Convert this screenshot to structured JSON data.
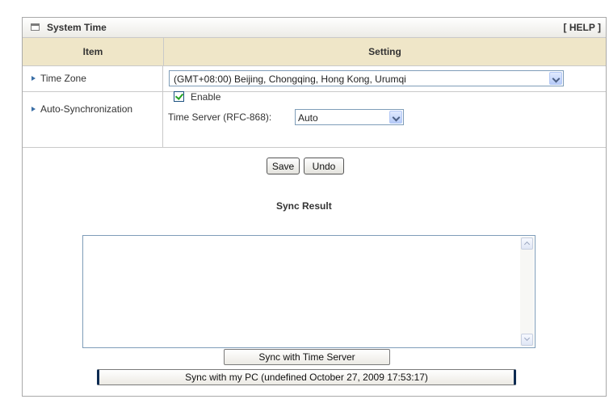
{
  "panel": {
    "title": "System Time",
    "help": "[ HELP ]"
  },
  "table": {
    "col_item": "Item",
    "col_setting": "Setting"
  },
  "time_zone": {
    "label": "Time Zone",
    "selected": "(GMT+08:00) Beijing, Chongqing, Hong Kong, Urumqi"
  },
  "auto_sync": {
    "label": "Auto-Synchronization",
    "enable_label": "Enable",
    "enable_checked": true,
    "server_label": "Time Server (RFC-868):",
    "server_selected": "Auto"
  },
  "actions": {
    "save": "Save",
    "undo": "Undo"
  },
  "sync_result": {
    "title": "Sync Result",
    "content": ""
  },
  "buttons": {
    "sync_server": "Sync with Time Server",
    "sync_pc": "Sync with my PC (undefined October 27, 2009 17:53:17)"
  },
  "colors": {
    "header_bg": "#efe6c8",
    "border": "#c9c9c9",
    "bullet": "#3a6ea5",
    "check": "#21a121"
  }
}
